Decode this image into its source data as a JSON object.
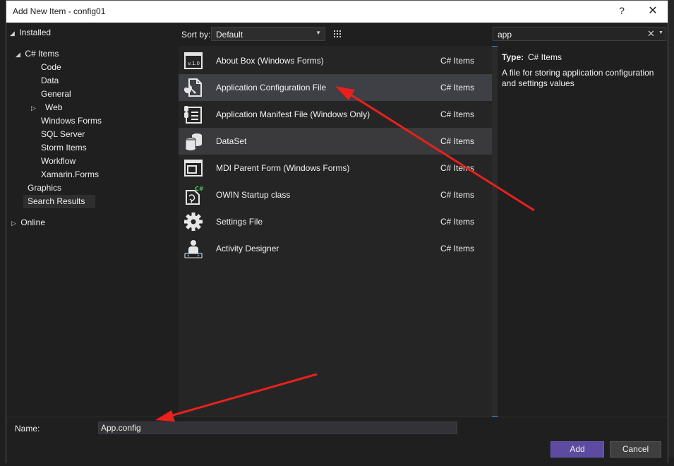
{
  "window": {
    "title": "Add New Item - config01",
    "help": "?",
    "close": "✕"
  },
  "tree": {
    "installed": "Installed",
    "csharp_items": "C# Items",
    "children": [
      "Code",
      "Data",
      "General",
      "Web",
      "Windows Forms",
      "SQL Server",
      "Storm Items",
      "Workflow",
      "Xamarin.Forms"
    ],
    "graphics": "Graphics",
    "search_results": "Search Results",
    "online": "Online"
  },
  "toolbar": {
    "sort_label": "Sort by:",
    "sort_value": "Default"
  },
  "search": {
    "value": "app"
  },
  "templates": [
    {
      "name": "About Box (Windows Forms)",
      "category": "C# Items",
      "icon": "about-box-icon"
    },
    {
      "name": "Application Configuration File",
      "category": "C# Items",
      "icon": "config-file-icon"
    },
    {
      "name": "Application Manifest File (Windows Only)",
      "category": "C# Items",
      "icon": "manifest-file-icon"
    },
    {
      "name": "DataSet",
      "category": "C# Items",
      "icon": "dataset-icon"
    },
    {
      "name": "MDI Parent Form (Windows Forms)",
      "category": "C# Items",
      "icon": "mdi-form-icon"
    },
    {
      "name": "OWIN Startup class",
      "category": "C# Items",
      "icon": "owin-class-icon"
    },
    {
      "name": "Settings File",
      "category": "C# Items",
      "icon": "settings-gear-icon"
    },
    {
      "name": "Activity Designer",
      "category": "C# Items",
      "icon": "activity-designer-icon"
    }
  ],
  "details": {
    "type_label": "Type:",
    "type_value": "C# Items",
    "description": "A file for storing application configuration and settings values"
  },
  "footer": {
    "name_label": "Name:",
    "name_value": "App.config",
    "add_label": "Add",
    "cancel_label": "Cancel"
  },
  "colors": {
    "accent": "#5c4ba0",
    "annotation": "#e8211c",
    "selected_row": "#3f3f46"
  }
}
